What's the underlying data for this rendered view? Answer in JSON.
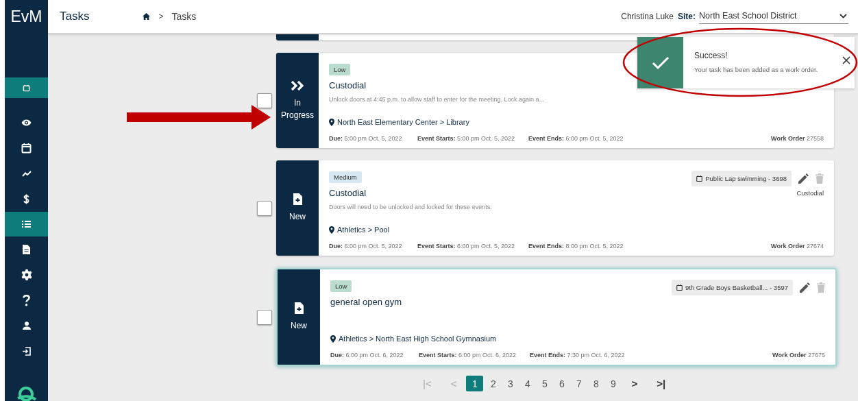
{
  "header": {
    "logo": "EvM",
    "title": "Tasks",
    "breadcrumb_separator": ">",
    "breadcrumb": "Tasks",
    "user": "Christina Luke",
    "site_label": "Site:",
    "site_value": "North East School District"
  },
  "sidebar": {
    "items": [
      {
        "kind": "calendar-small",
        "selected": true
      },
      {
        "kind": "eye",
        "selected": false
      },
      {
        "kind": "calendar",
        "selected": false
      },
      {
        "kind": "trend",
        "selected": false
      },
      {
        "kind": "dollar",
        "selected": false
      },
      {
        "kind": "list",
        "selected": true
      },
      {
        "kind": "file",
        "selected": false
      },
      {
        "kind": "gear",
        "selected": false
      },
      {
        "kind": "question",
        "selected": false
      },
      {
        "kind": "user",
        "selected": false
      },
      {
        "kind": "logout",
        "selected": false
      }
    ]
  },
  "toast": {
    "title": "Success!",
    "message": "Your task has been added as a work order."
  },
  "tasks": [
    {
      "checked": false,
      "highlighted": false,
      "status": {
        "kind": "in_progress",
        "label": "In Progress"
      },
      "priority": {
        "kind": "low",
        "label": "Low"
      },
      "title": "Custodial",
      "description": "Unlock doors at 4:45 p.m. to allow staff to enter for the meeting. Lock again a...",
      "location": "North East Elementary Center > Library",
      "due_label": "Due:",
      "due": "5:00 pm Oct. 5, 2022",
      "starts_label": "Event Starts:",
      "starts": "5:00 pm Oct. 5, 2022",
      "ends_label": "Event Ends:",
      "ends": "6:00 pm Oct. 5, 2022",
      "work_order_label": "Work Order",
      "work_order": "27558"
    },
    {
      "checked": false,
      "highlighted": false,
      "status": {
        "kind": "new",
        "label": "New"
      },
      "priority": {
        "kind": "medium",
        "label": "Medium"
      },
      "title": "Custodial",
      "description": "Doors will need to be unlocked and locked for these events.",
      "location": "Athletics > Pool",
      "event": "Public Lap swimming - 3698",
      "category": "Custodial",
      "due_label": "Due:",
      "due": "6:00 pm Oct. 5, 2022",
      "starts_label": "Event Starts:",
      "starts": "6:00 pm Oct. 5, 2022",
      "ends_label": "Event Ends:",
      "ends": "8:00 pm Oct. 5, 2022",
      "work_order_label": "Work Order",
      "work_order": "27674"
    },
    {
      "checked": false,
      "highlighted": true,
      "status": {
        "kind": "new",
        "label": "New"
      },
      "priority": {
        "kind": "low",
        "label": "Low"
      },
      "title": "general open gym",
      "location": "Athletics > North East High School Gymnasium",
      "event": "9th Grade Boys Basketball... - 3597",
      "due_label": "Due:",
      "due": "6:00 pm Oct. 6, 2022",
      "starts_label": "Event Starts:",
      "starts": "6:00 pm Oct. 6, 2022",
      "ends_label": "Event Ends:",
      "ends": "7:30 pm Oct. 6, 2022",
      "work_order_label": "Work Order",
      "work_order": "27675"
    }
  ],
  "pagination": {
    "first": "|<",
    "prev": "<",
    "next": ">",
    "last": ">|",
    "pages": [
      {
        "label": "1",
        "selected": true
      },
      {
        "label": "2",
        "selected": false
      },
      {
        "label": "3",
        "selected": false
      },
      {
        "label": "4",
        "selected": false
      },
      {
        "label": "5",
        "selected": false
      },
      {
        "label": "6",
        "selected": false
      },
      {
        "label": "7",
        "selected": false
      },
      {
        "label": "8",
        "selected": false
      },
      {
        "label": "9",
        "selected": false
      }
    ]
  }
}
